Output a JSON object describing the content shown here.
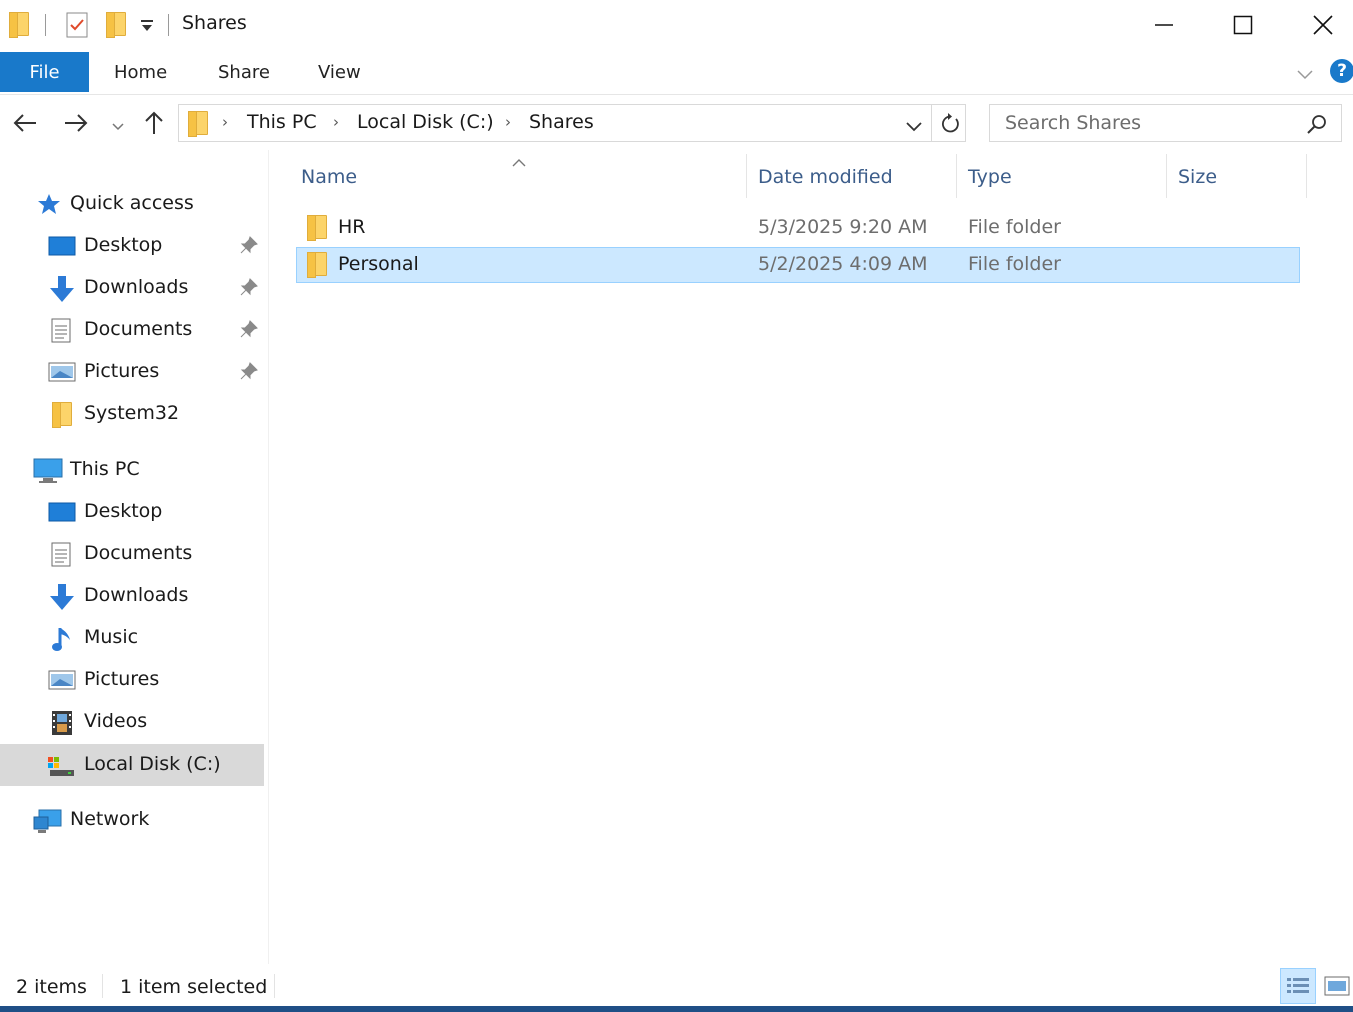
{
  "window": {
    "title": "Shares"
  },
  "ribbon": {
    "tabs": [
      "File",
      "Home",
      "Share",
      "View"
    ]
  },
  "address": {
    "breadcrumbs": [
      "This PC",
      "Local Disk (C:)",
      "Shares"
    ],
    "search_placeholder": "Search Shares"
  },
  "nav": {
    "quick_access": {
      "label": "Quick access",
      "items": [
        {
          "label": "Desktop",
          "icon": "desktop-icon",
          "pinned": true
        },
        {
          "label": "Downloads",
          "icon": "downloads-icon",
          "pinned": true
        },
        {
          "label": "Documents",
          "icon": "documents-icon",
          "pinned": true
        },
        {
          "label": "Pictures",
          "icon": "pictures-icon",
          "pinned": true
        },
        {
          "label": "System32",
          "icon": "folder-icon",
          "pinned": false
        }
      ]
    },
    "this_pc": {
      "label": "This PC",
      "items": [
        {
          "label": "Desktop",
          "icon": "desktop-icon"
        },
        {
          "label": "Documents",
          "icon": "documents-icon"
        },
        {
          "label": "Downloads",
          "icon": "downloads-icon"
        },
        {
          "label": "Music",
          "icon": "music-icon"
        },
        {
          "label": "Pictures",
          "icon": "pictures-icon"
        },
        {
          "label": "Videos",
          "icon": "videos-icon"
        },
        {
          "label": "Local Disk (C:)",
          "icon": "drive-icon",
          "selected": true
        }
      ]
    },
    "network": {
      "label": "Network"
    }
  },
  "list": {
    "columns": [
      "Name",
      "Date modified",
      "Type",
      "Size"
    ],
    "rows": [
      {
        "name": "HR",
        "date": "5/3/2025 9:20 AM",
        "type": "File folder",
        "size": "",
        "selected": false
      },
      {
        "name": "Personal",
        "date": "5/2/2025 4:09 AM",
        "type": "File folder",
        "size": "",
        "selected": true
      }
    ]
  },
  "status": {
    "count": "2 items",
    "selection": "1 item selected"
  },
  "colors": {
    "accent": "#1979ca",
    "selection_bg": "#cce8ff",
    "selection_border": "#99d1ff",
    "nav_selected_bg": "#d9d9d9"
  }
}
